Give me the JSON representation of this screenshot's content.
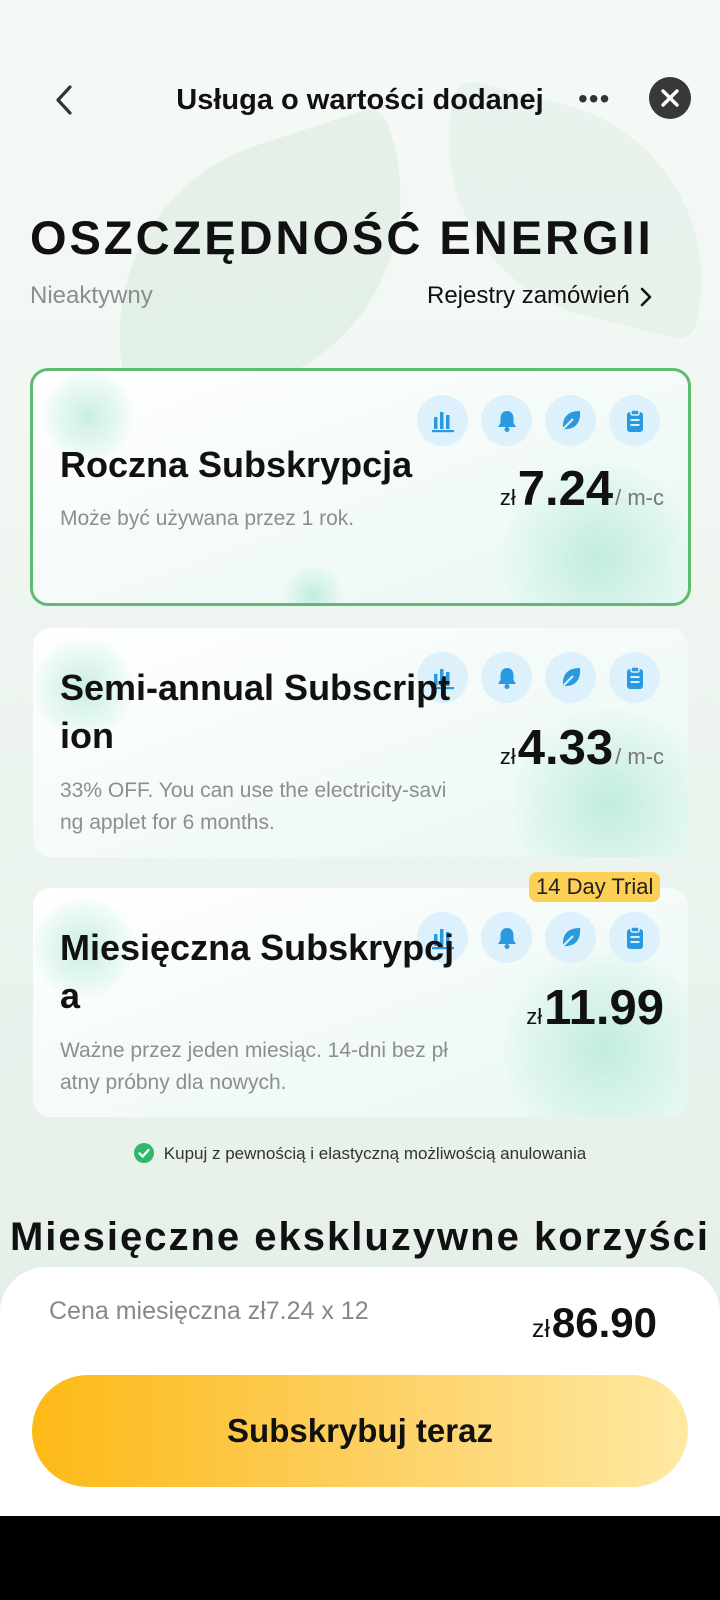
{
  "header": {
    "title": "Usługa o wartości dodanej",
    "more_label": "•••"
  },
  "hero": {
    "title": "OSZCZĘDNOŚĆ ENERGII",
    "status": "Nieaktywny",
    "orders_link": "Rejestry zamówień"
  },
  "plans": [
    {
      "name": "Roczna Subskrypcja",
      "description": "Może być używana przez 1 rok.",
      "currency": "zł",
      "price": "7.24",
      "per": "/ m-c",
      "selected": true
    },
    {
      "name": "Semi-annual Subscription",
      "description": "33% OFF. You can use the electricity-saving applet for 6 months.",
      "currency": "zł",
      "price": "4.33",
      "per": "/ m-c",
      "selected": false
    },
    {
      "name": "Miesięczna Subskrypcja",
      "description": "Ważne przez jeden miesiąc. 14-dni bez płatny próbny dla nowych.",
      "currency": "zł",
      "price": "11.99",
      "badge": "14 Day Trial",
      "selected": false
    }
  ],
  "plan_icons": [
    "bar-chart-icon",
    "bell-icon",
    "leaf-icon",
    "clipboard-icon"
  ],
  "guarantee": "Kupuj z pewnością i elastyczną możliwością anulowania",
  "benefits_title": "Miesięczne ekskluzywne korzyści",
  "summary": {
    "monthly_price": "Cena miesięczna zł7.24 x 12",
    "total_currency": "zł",
    "total_amount": "86.90"
  },
  "cta_label": "Subskrybuj teraz",
  "colors": {
    "accent": "#fdb916",
    "selected_border": "#5fbb6f",
    "icon_blue": "#2a9ae0",
    "badge": "#fccf55"
  }
}
